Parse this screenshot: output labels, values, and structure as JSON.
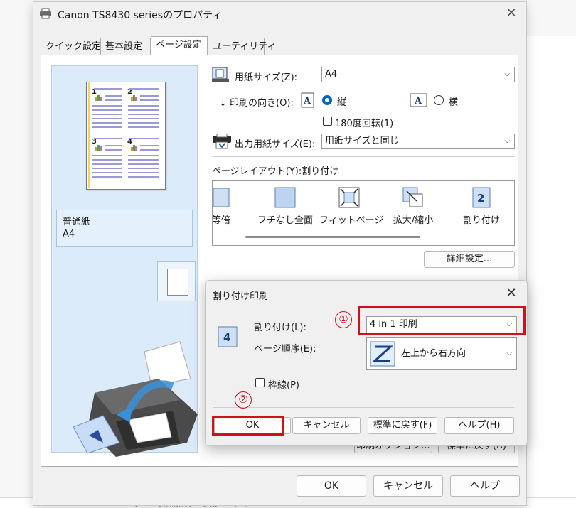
{
  "window": {
    "title": "Canon TS8430 seriesのプロパティ"
  },
  "tabs": [
    "クイック設定",
    "基本設定",
    "ページ設定",
    "ユーティリティ"
  ],
  "preview": {
    "media_type": "普通紙",
    "media_size": "A4",
    "quadrants": [
      "1",
      "2",
      "3",
      "4"
    ]
  },
  "settings": {
    "paper_size_label": "用紙サイズ(Z):",
    "paper_size_value": "A4",
    "orientation_label": "印刷の向き(O):",
    "portrait_label": "縦",
    "landscape_label": "横",
    "rotate_label": "180度回転(1)",
    "output_size_label": "出力用紙サイズ(E):",
    "output_size_value": "用紙サイズと同じ",
    "layout_label": "ページレイアウト(Y):割り付け",
    "layout_items": [
      "等倍",
      "フチなし全面",
      "フィットページ",
      "拡大/縮小",
      "割り付け"
    ],
    "layout_icon_number": "2",
    "detail_button": "詳細設定...",
    "hidden_buttons": [
      "印刷オプション...",
      "標準に戻す(R)"
    ]
  },
  "footer": {
    "ok": "OK",
    "cancel": "キャンセル",
    "help": "ヘルプ"
  },
  "subdialog": {
    "title": "割り付け印刷",
    "icon_number": "4",
    "pages_label": "割り付け(L):",
    "pages_value": "4 in 1 印刷",
    "order_label": "ページ順序(E):",
    "order_value": "左上から右方向",
    "border_label": "枠線(P)",
    "ok": "OK",
    "cancel": "キャンセル",
    "defaults": "標準に戻す(F)",
    "help": "ヘルプ(H)"
  },
  "annotations": {
    "step1": "①",
    "step2": "②",
    "highlight_color": "#d0101a"
  },
  "background_strip": "[C0002] [新規作] [OO事項] 2025/12/15 20 11 10"
}
